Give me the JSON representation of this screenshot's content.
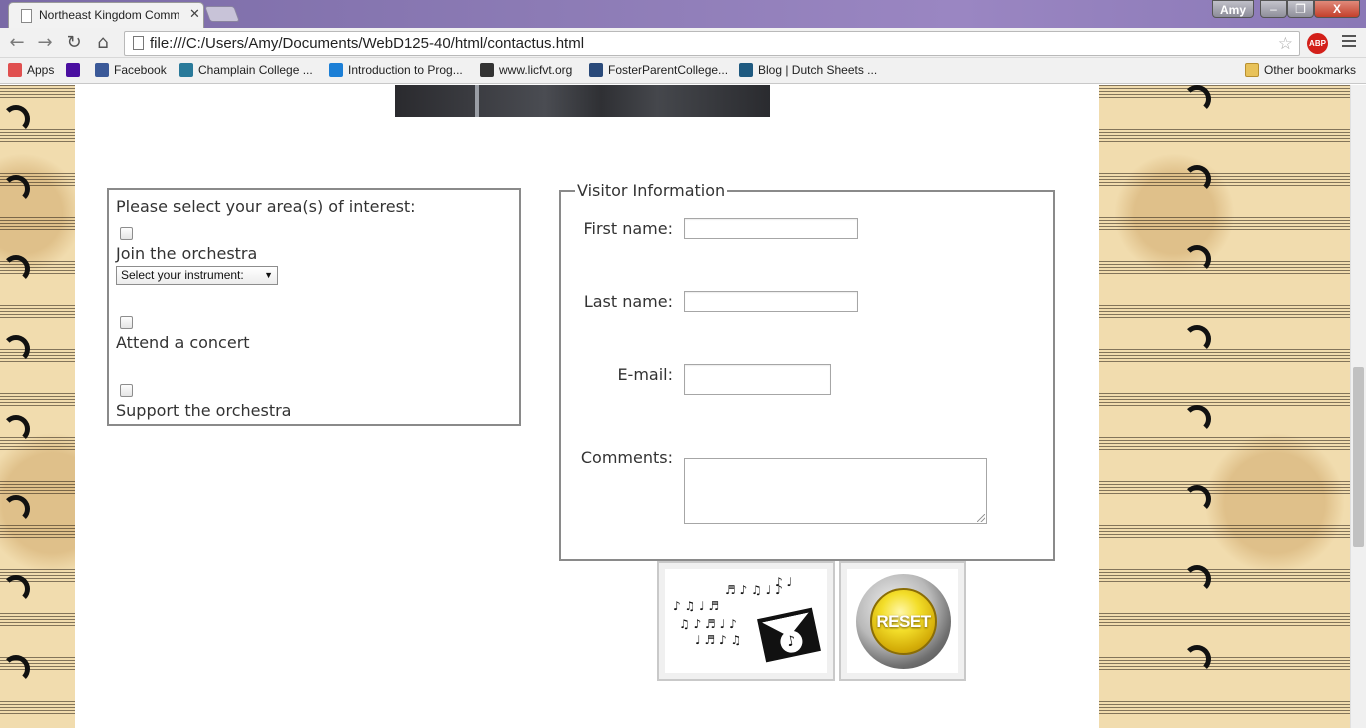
{
  "browser": {
    "tab_title": "Northeast Kingdom Comm",
    "tab_close": "✕",
    "user": "Amy",
    "win_min": "–",
    "win_max": "❐",
    "win_close": "X",
    "url": "file:///C:/Users/Amy/Documents/WebD125-40/html/contactus.html",
    "back_icon": "←",
    "forward_icon": "→",
    "reload_icon": "↻",
    "home_icon": "⌂",
    "star_icon": "☆",
    "abp_label": "ABP"
  },
  "bookmarks": {
    "items": [
      "Apps",
      "Facebook",
      "Champlain College ...",
      "Introduction to Prog...",
      "www.licfvt.org",
      "FosterParentCollege...",
      "Blog | Dutch Sheets ..."
    ],
    "other": "Other bookmarks",
    "icon_colors": [
      "#e05050",
      "#4a0fa0",
      "#3b5998",
      "#2a7a9a",
      "#1c7fd6",
      "#333333",
      "#2a4a7a",
      "#1f5a80"
    ]
  },
  "interest": {
    "prompt": "Please select your area(s) of interest:",
    "options": [
      "Join the orchestra",
      "Attend a concert",
      "Support the orchestra"
    ],
    "instrument_select": "Select your instrument:",
    "select_arrow": "▼"
  },
  "visitor": {
    "legend": "Visitor Information",
    "first_name_label": "First name:",
    "last_name_label": "Last name:",
    "email_label": "E-mail:",
    "comments_label": "Comments:"
  },
  "buttons": {
    "reset_label": "RESET",
    "submit_glyph": "♪"
  }
}
